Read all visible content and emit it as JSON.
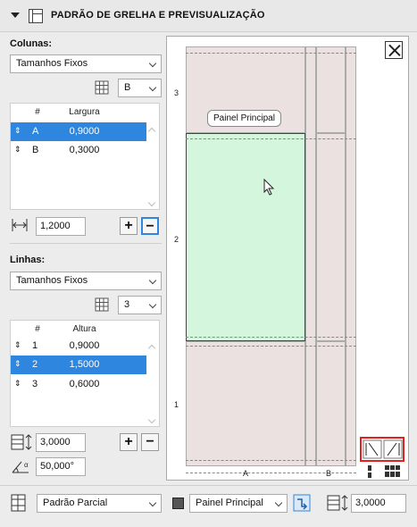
{
  "header": {
    "title": "PADRÃO DE GRELHA E PREVISUALIZAÇÃO"
  },
  "columns": {
    "label": "Colunas:",
    "type_value": "Tamanhos Fixos",
    "selected": "B",
    "table_headers": [
      "#",
      "Largura"
    ],
    "rows": [
      {
        "id": "A",
        "value": "0,9000",
        "selected": true
      },
      {
        "id": "B",
        "value": "0,3000",
        "selected": false
      }
    ],
    "total": "1,2000"
  },
  "rows": {
    "label": "Linhas:",
    "type_value": "Tamanhos Fixos",
    "selected": "3",
    "table_headers": [
      "#",
      "Altura"
    ],
    "rows": [
      {
        "id": "1",
        "value": "0,9000",
        "selected": false
      },
      {
        "id": "2",
        "value": "1,5000",
        "selected": true
      },
      {
        "id": "3",
        "value": "0,6000",
        "selected": false
      }
    ],
    "total": "3,0000",
    "angle": "50,000°"
  },
  "preview": {
    "tooltip": "Painel Principal",
    "row_labels": [
      "3",
      "2",
      "1"
    ],
    "col_labels": [
      "A",
      "B"
    ]
  },
  "footer": {
    "pattern_value": "Padrão Parcial",
    "panel_value": "Painel Principal",
    "height_value": "3,0000"
  },
  "colors": {
    "accent": "#2e86de",
    "highlight": "#e32020",
    "panel_green": "#d4f6dc"
  }
}
